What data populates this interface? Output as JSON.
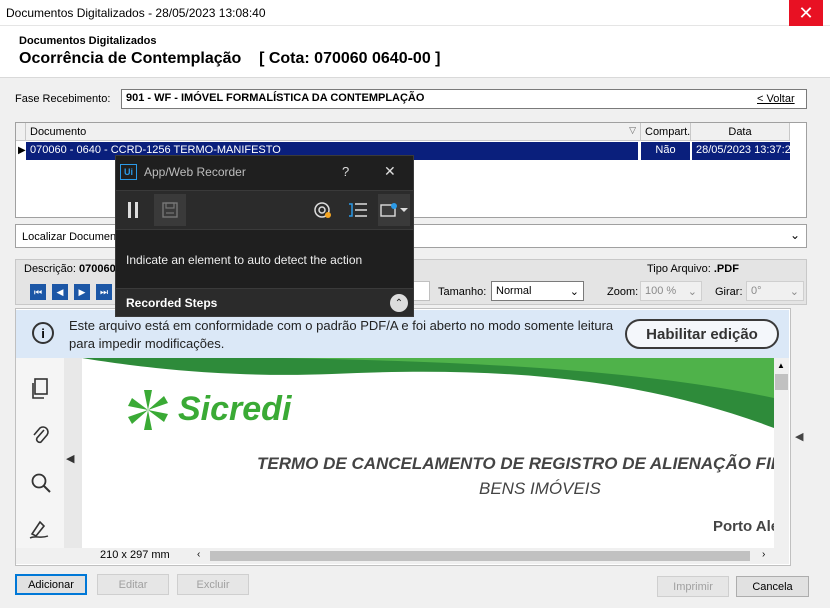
{
  "window": {
    "title": "Documentos Digitalizados - 28/05/2023  13:08:40",
    "close_glyph": "✕"
  },
  "header": {
    "subtitle": "Documentos Digitalizados",
    "title": "Ocorrência de Contemplação    [ Cota: 070060 0640-00 ]"
  },
  "fase": {
    "label": "Fase Recebimento:",
    "value": "901 - WF - IMÓVEL FORMALÍSTICA DA CONTEMPLAÇÃO",
    "voltar": "< Voltar"
  },
  "grid": {
    "headers": {
      "documento": "Documento",
      "compart": "Compart.",
      "data": "Data"
    },
    "rows": [
      {
        "documento": "070060 - 0640 - CCRD-1256 TERMO-MANIFESTO",
        "compart": "Não",
        "data": "28/05/2023 13:37:26"
      }
    ]
  },
  "localizar": {
    "label": "Localizar Document"
  },
  "viewer": {
    "descricao_label": "Descrição:",
    "descricao_value": "070060",
    "tipo_label": "Tipo Arquivo:",
    "tipo_value": ".PDF",
    "tamanho_label": "Tamanho:",
    "tamanho_value": "Normal",
    "zoom_label": "Zoom:",
    "zoom_value": "100 %",
    "girar_label": "Girar:",
    "girar_value": "0°"
  },
  "pdf": {
    "info_text": "Este arquivo está em conformidade com o padrão PDF/A e foi aberto no modo somente leitura para impedir modificações.",
    "enable_edit": "Habilitar edição",
    "logo_text": "Sicredi",
    "doc_title": "TERMO DE CANCELAMENTO DE REGISTRO DE ALIENAÇÃO FIDUCI",
    "doc_subtitle": "BENS IMÓVEIS",
    "doc_place": "Porto Ale",
    "page_size": "210 x 297 mm"
  },
  "recorder": {
    "title": "App/Web Recorder",
    "help": "?",
    "close": "✕",
    "instruction": "Indicate an element to auto detect the action",
    "steps_label": "Recorded Steps",
    "icon_label": "Ui"
  },
  "footer": {
    "adicionar": "Adicionar",
    "editar": "Editar",
    "excluir": "Excluir",
    "imprimir": "Imprimir",
    "cancela": "Cancela"
  },
  "colors": {
    "selection": "#0a1f7c",
    "sicredi_green": "#3aaa35",
    "close_red": "#e81123",
    "recorder_bg": "#1f1f1f"
  }
}
